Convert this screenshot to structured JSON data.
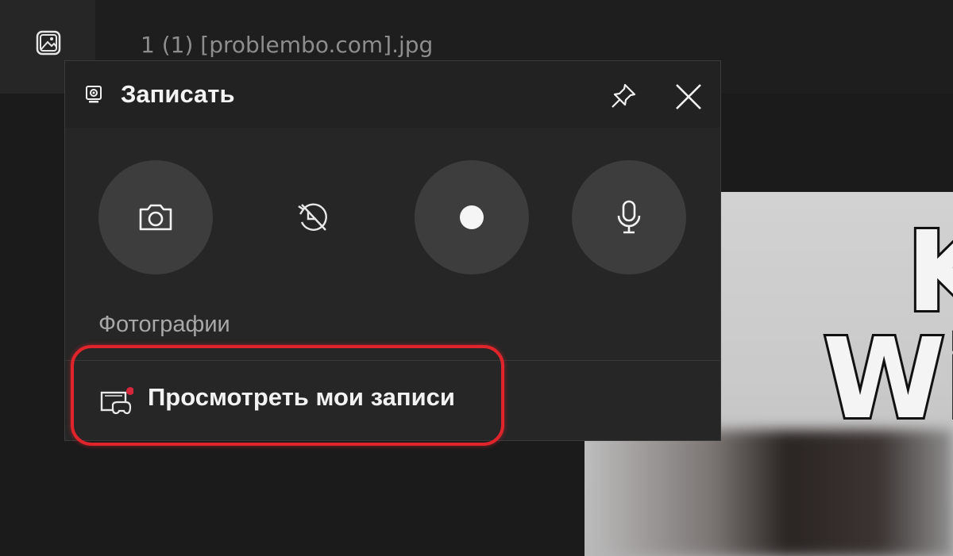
{
  "background": {
    "file_name": "1 (1) [problembo.com].jpg",
    "photo_text_line1": "K",
    "photo_text_line2": "Wi"
  },
  "widget": {
    "title": "Записать",
    "title_icon": "webcam-icon",
    "pin_icon": "pin-icon",
    "close_icon": "close-icon",
    "buttons": [
      {
        "name": "screenshot",
        "icon": "camera-icon"
      },
      {
        "name": "record-last-30s",
        "icon": "record-last-disabled-icon"
      },
      {
        "name": "start-recording",
        "icon": "record-dot-icon"
      },
      {
        "name": "microphone",
        "icon": "microphone-icon"
      }
    ],
    "section_label": "Фотографии",
    "gallery_link": "Просмотреть мои записи",
    "gallery_icon": "gallery-controller-icon"
  },
  "colors": {
    "highlight": "#e0242c",
    "notification_dot": "#d6263c"
  }
}
